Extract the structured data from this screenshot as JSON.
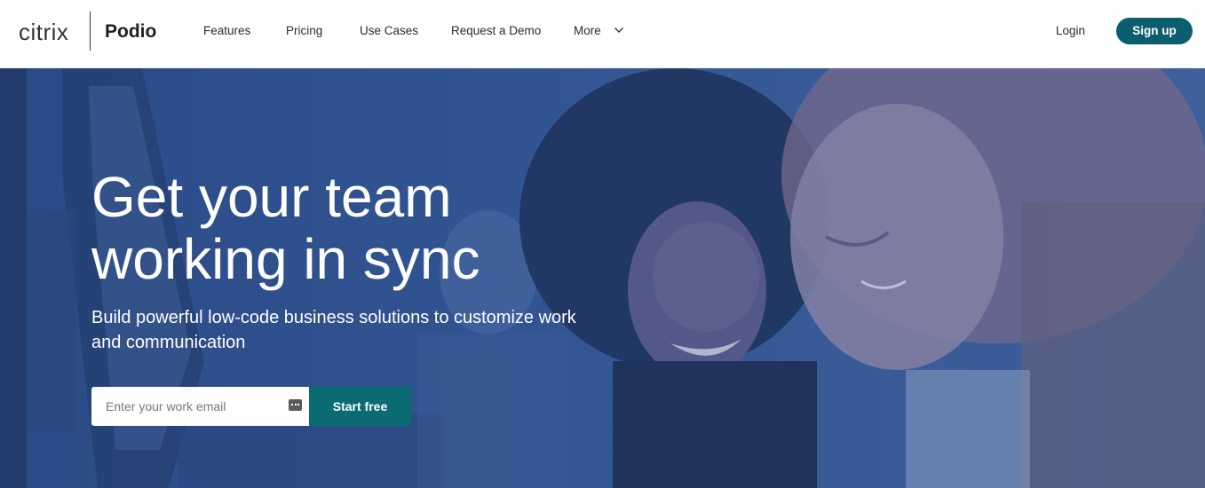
{
  "brand": {
    "citrix": "citrix",
    "podio": "Podio"
  },
  "nav": {
    "items": [
      "Features",
      "Pricing",
      "Use Cases",
      "Request a Demo",
      "More"
    ],
    "login": "Login",
    "signup": "Sign up"
  },
  "hero": {
    "title_line1": "Get your team",
    "title_line2": "working in sync",
    "subtitle": "Build powerful low-code business solutions to customize work and communication",
    "email_placeholder": "Enter your work email",
    "cta": "Start free"
  },
  "colors": {
    "accent": "#0b5e6d",
    "cta": "#0b6b73",
    "hero_overlay": "#345690"
  },
  "icons": {
    "more_chevron": "chevron-down-icon",
    "password_manager": "password-key-icon"
  }
}
